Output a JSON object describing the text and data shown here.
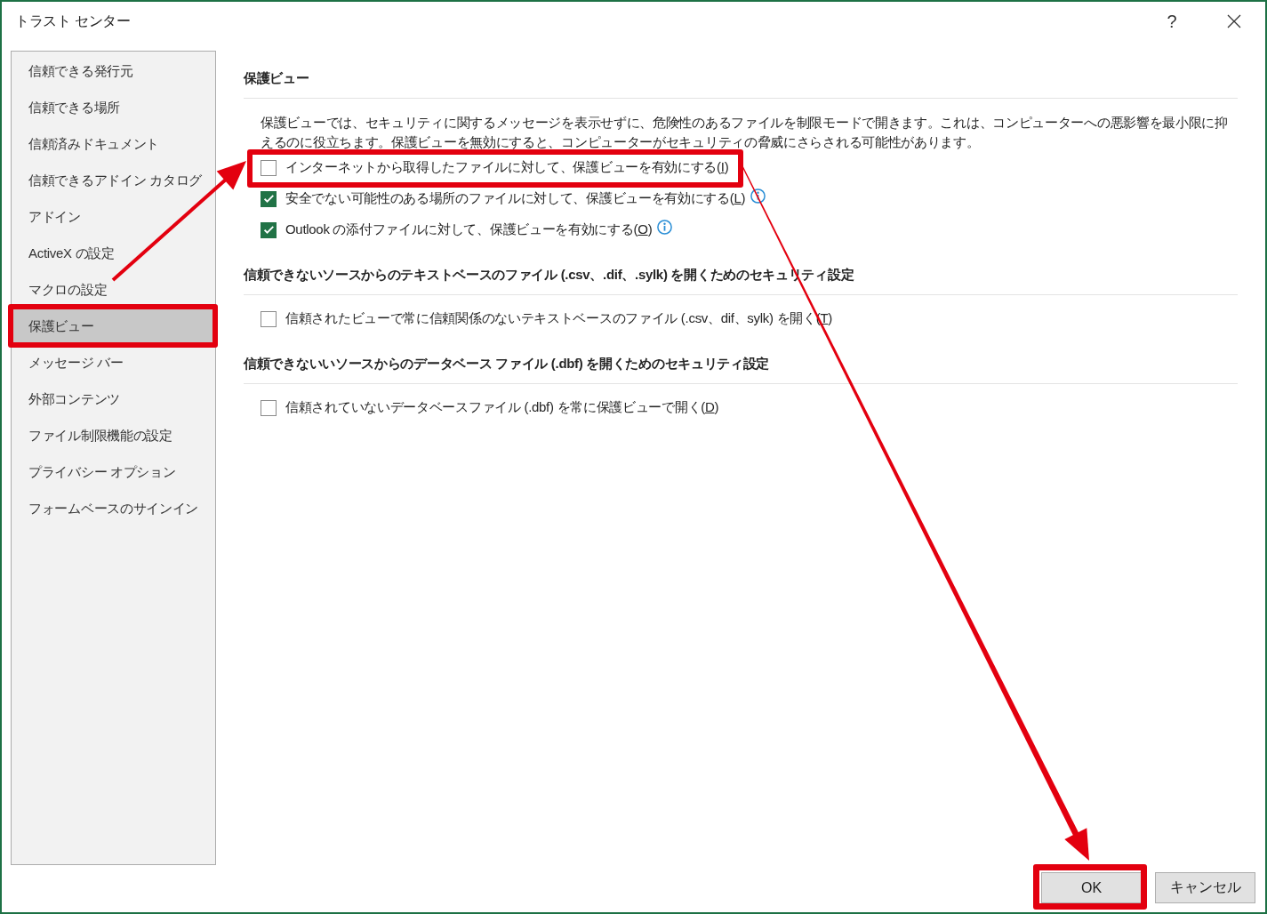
{
  "window": {
    "title": "トラスト センター",
    "help_button": "?"
  },
  "sidebar": {
    "items": [
      {
        "label": "信頼できる発行元",
        "selected": false,
        "highlighted": false
      },
      {
        "label": "信頼できる場所",
        "selected": false,
        "highlighted": false
      },
      {
        "label": "信頼済みドキュメント",
        "selected": false,
        "highlighted": false
      },
      {
        "label": "信頼できるアドイン カタログ",
        "selected": false,
        "highlighted": false
      },
      {
        "label": "アドイン",
        "selected": false,
        "highlighted": false
      },
      {
        "label": "ActiveX の設定",
        "selected": false,
        "highlighted": false
      },
      {
        "label": "マクロの設定",
        "selected": false,
        "highlighted": false
      },
      {
        "label": "保護ビュー",
        "selected": true,
        "highlighted": true
      },
      {
        "label": "メッセージ バー",
        "selected": false,
        "highlighted": false
      },
      {
        "label": "外部コンテンツ",
        "selected": false,
        "highlighted": false
      },
      {
        "label": "ファイル制限機能の設定",
        "selected": false,
        "highlighted": false
      },
      {
        "label": "プライバシー オプション",
        "selected": false,
        "highlighted": false
      },
      {
        "label": "フォームベースのサインイン",
        "selected": false,
        "highlighted": false
      }
    ]
  },
  "sections": [
    {
      "heading": "保護ビュー",
      "description": "保護ビューでは、セキュリティに関するメッセージを表示せずに、危険性のあるファイルを制限モードで開きます。これは、コンピューターへの悪影響を最小限に抑えるのに役立ちます。保護ビューを無効にすると、コンピューターがセキュリティの脅威にさらされる可能性があります。",
      "options": [
        {
          "label_start": "インターネットから取得したファイルに対して、保護ビューを有効にする(",
          "access_key": "I",
          "label_end": ")",
          "checked": false,
          "info": false,
          "highlighted": true
        },
        {
          "label_start": "安全でない可能性のある場所のファイルに対して、保護ビューを有効にする(",
          "access_key": "L",
          "label_end": ")",
          "checked": true,
          "info": true,
          "highlighted": false
        },
        {
          "label_start": "Outlook の添付ファイルに対して、保護ビューを有効にする(",
          "access_key": "O",
          "label_end": ")",
          "checked": true,
          "info": true,
          "highlighted": false
        }
      ]
    },
    {
      "heading": "信頼できないソースからのテキストベースのファイル (.csv、.dif、.sylk) を開くためのセキュリティ設定",
      "options": [
        {
          "label_start": "信頼されたビューで常に信頼関係のないテキストベースのファイル (.csv、dif、sylk) を開く(",
          "access_key": "T",
          "label_end": ")",
          "checked": false,
          "info": false,
          "highlighted": false
        }
      ]
    },
    {
      "heading": "信頼できないいソースからのデータベース ファイル (.dbf) を開くためのセキュリティ設定",
      "options": [
        {
          "label_start": "信頼されていないデータベースファイル (.dbf) を常に保護ビューで開く(",
          "access_key": "D",
          "label_end": ")",
          "checked": false,
          "info": false,
          "highlighted": false
        }
      ]
    }
  ],
  "buttons": [
    {
      "label": "OK",
      "highlighted": true
    },
    {
      "label": "キャンセル",
      "highlighted": false
    }
  ]
}
